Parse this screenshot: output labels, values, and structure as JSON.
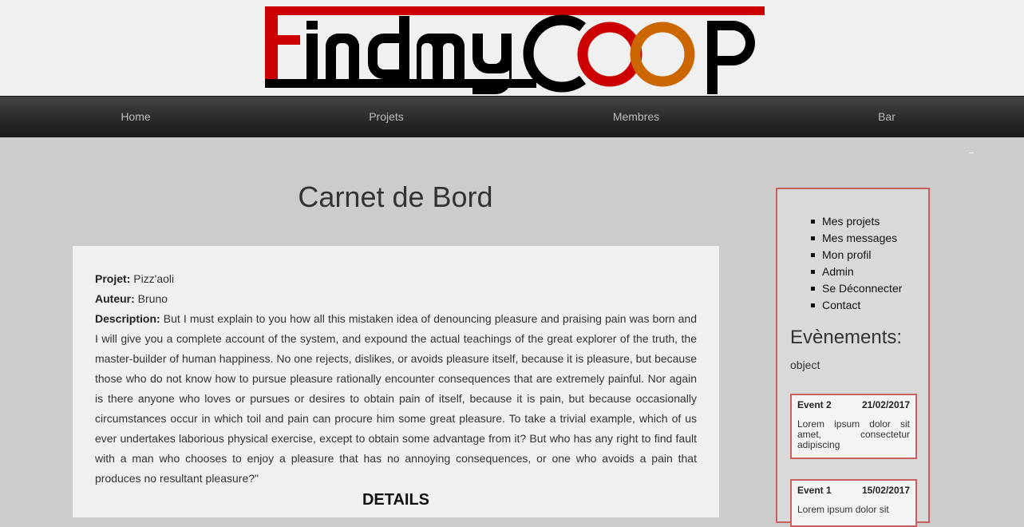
{
  "brand": {
    "logo_text": "FindmyCOOP",
    "colors": {
      "red": "#cc0000",
      "black": "#000000",
      "orange": "#cc6600"
    }
  },
  "nav": {
    "items": [
      {
        "label": "Home"
      },
      {
        "label": "Projets"
      },
      {
        "label": "Membres"
      },
      {
        "label": "Bar"
      }
    ]
  },
  "page": {
    "title": "Carnet de Bord"
  },
  "entry": {
    "projet_label": "Projet:",
    "projet_value": "Pizz'aoli",
    "auteur_label": "Auteur:",
    "auteur_value": "Bruno",
    "description_label": "Description:",
    "description_value": "But I must explain to you how all this mistaken idea of denouncing pleasure and praising pain was born and I will give you a complete account of the system, and expound the actual teachings of the great explorer of the truth, the master-builder of human happiness. No one rejects, dislikes, or avoids pleasure itself, because it is pleasure, but because those who do not know how to pursue pleasure rationally encounter consequences that are extremely painful. Nor again is there anyone who loves or pursues or desires to obtain pain of itself, because it is pain, but because occasionally circumstances occur in which toil and pain can procure him some great pleasure. To take a trivial example, which of us ever undertakes laborious physical exercise, except to obtain some advantage from it? But who has any right to find fault with a man who chooses to enjoy a pleasure that has no annoying consequences, or one who avoids a pain that produces no resultant pleasure?\"",
    "details_title": "DETAILS"
  },
  "sidebar": {
    "menu": [
      {
        "label": "Mes projets"
      },
      {
        "label": "Mes messages"
      },
      {
        "label": "Mon profil"
      },
      {
        "label": "Admin"
      },
      {
        "label": "Se Déconnecter"
      },
      {
        "label": "Contact"
      }
    ],
    "events_title": "Evènements:",
    "events_object": "object",
    "events": [
      {
        "name": "Event 2",
        "date": "21/02/2017",
        "text": "Lorem ipsum dolor sit amet, consectetur adipiscing"
      },
      {
        "name": "Event 1",
        "date": "15/02/2017",
        "text": "Lorem ipsum dolor sit"
      }
    ]
  }
}
